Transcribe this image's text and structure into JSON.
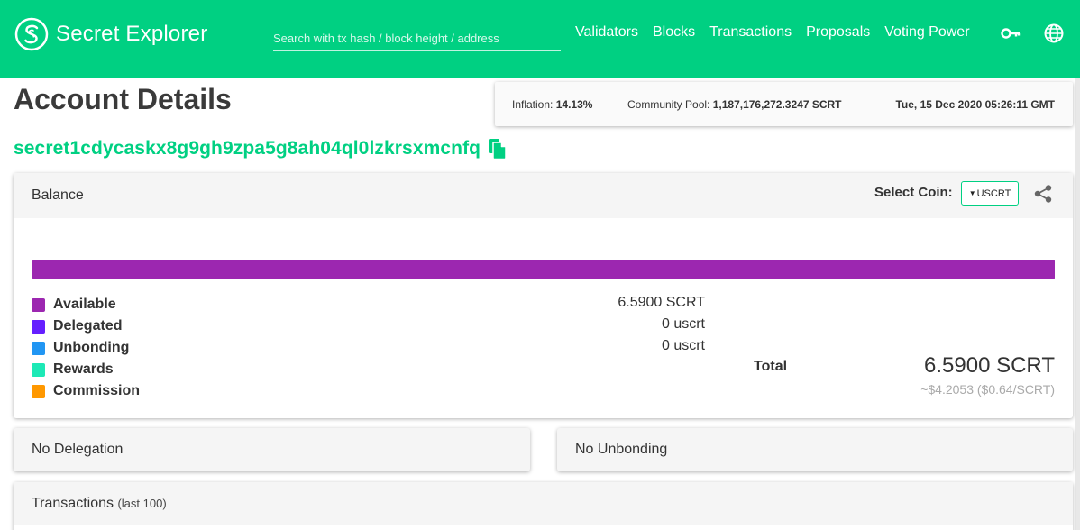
{
  "nav": {
    "brand": "Secret Explorer",
    "search_placeholder": "Search with tx hash / block height / address",
    "links": [
      "Validators",
      "Blocks",
      "Transactions",
      "Proposals",
      "Voting Power"
    ],
    "icons": [
      "key-icon",
      "globe-icon"
    ]
  },
  "page": {
    "title": "Account Details"
  },
  "status": {
    "inflation_label": "Inflation:",
    "inflation_value": "14.13%",
    "pool_label": "Community Pool:",
    "pool_value": "1,187,176,272.3247 SCRT",
    "time": "Tue, 15 Dec 2020 05:26:11 GMT"
  },
  "account": {
    "address": "secret1cdycaskx8g9gh9zpa5g8ah04ql0lzkrsxmcnfq"
  },
  "balance": {
    "title": "Balance",
    "select_label": "Select Coin:",
    "selected_coin": "USCRT",
    "bar_available_fraction": 1.0,
    "bar_color": "#9c27b0",
    "rows": [
      {
        "label": "Available",
        "amount": "6.5900 SCRT",
        "color": "#9c27b0"
      },
      {
        "label": "Delegated",
        "amount": "0 uscrt",
        "color": "#651fff"
      },
      {
        "label": "Unbonding",
        "amount": "0 uscrt",
        "color": "#2196f3"
      },
      {
        "label": "Rewards",
        "amount": "",
        "color": "#1de9b6"
      },
      {
        "label": "Commission",
        "amount": "",
        "color": "#ff9800"
      }
    ],
    "total_label": "Total",
    "total_value": "6.5900 SCRT",
    "total_fiat": "~$4.2053 ($0.64/SCRT)"
  },
  "delegation": {
    "title": "No Delegation"
  },
  "unbonding": {
    "title": "No Unbonding"
  },
  "transactions": {
    "title": "Transactions",
    "subtitle": "(last 100)"
  },
  "colors": {
    "brand": "#00d082",
    "text": "#333333"
  }
}
